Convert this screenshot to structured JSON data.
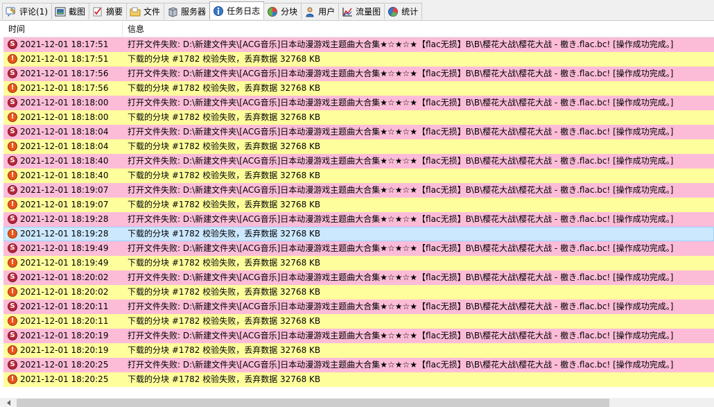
{
  "tabs": [
    {
      "label": "评论(1)",
      "icon": "comment-icon",
      "active": false
    },
    {
      "label": "截图",
      "icon": "screenshot-icon",
      "active": false
    },
    {
      "label": "摘要",
      "icon": "summary-icon",
      "active": false
    },
    {
      "label": "文件",
      "icon": "file-icon",
      "active": false
    },
    {
      "label": "服务器",
      "icon": "server-icon",
      "active": false
    },
    {
      "label": "任务日志",
      "icon": "task-log-icon",
      "active": true
    },
    {
      "label": "分块",
      "icon": "chunk-icon",
      "active": false
    },
    {
      "label": "用户",
      "icon": "user-icon",
      "active": false
    },
    {
      "label": "流量图",
      "icon": "traffic-chart-icon",
      "active": false
    },
    {
      "label": "统计",
      "icon": "statistics-icon",
      "active": false
    }
  ],
  "log": {
    "columns": {
      "time": "时间",
      "info": "信息"
    },
    "rows": [
      {
        "type": "error",
        "time": "2021-12-01 18:17:51",
        "message": "打开文件失败: D:\\新建文件夹\\[ACG音乐]日本动漫游戏主题曲大合集★☆★☆★【flac无损】B\\B\\樱花大战\\樱花大战 - 檄き.flac.bc! [操作成功完成。]"
      },
      {
        "type": "warning",
        "time": "2021-12-01 18:17:51",
        "message": "下载的分块 #1782 校验失败，丢弃数据 32768 KB"
      },
      {
        "type": "error",
        "time": "2021-12-01 18:17:56",
        "message": "打开文件失败: D:\\新建文件夹\\[ACG音乐]日本动漫游戏主题曲大合集★☆★☆★【flac无损】B\\B\\樱花大战\\樱花大战 - 檄き.flac.bc! [操作成功完成。]"
      },
      {
        "type": "warning",
        "time": "2021-12-01 18:17:56",
        "message": "下载的分块 #1782 校验失败，丢弃数据 32768 KB"
      },
      {
        "type": "error",
        "time": "2021-12-01 18:18:00",
        "message": "打开文件失败: D:\\新建文件夹\\[ACG音乐]日本动漫游戏主题曲大合集★☆★☆★【flac无损】B\\B\\樱花大战\\樱花大战 - 檄き.flac.bc! [操作成功完成。]"
      },
      {
        "type": "warning",
        "time": "2021-12-01 18:18:00",
        "message": "下载的分块 #1782 校验失败，丢弃数据 32768 KB"
      },
      {
        "type": "error",
        "time": "2021-12-01 18:18:04",
        "message": "打开文件失败: D:\\新建文件夹\\[ACG音乐]日本动漫游戏主题曲大合集★☆★☆★【flac无损】B\\B\\樱花大战\\樱花大战 - 檄き.flac.bc! [操作成功完成。]"
      },
      {
        "type": "warning",
        "time": "2021-12-01 18:18:04",
        "message": "下载的分块 #1782 校验失败，丢弃数据 32768 KB"
      },
      {
        "type": "error",
        "time": "2021-12-01 18:18:40",
        "message": "打开文件失败: D:\\新建文件夹\\[ACG音乐]日本动漫游戏主题曲大合集★☆★☆★【flac无损】B\\B\\樱花大战\\樱花大战 - 檄き.flac.bc! [操作成功完成。]"
      },
      {
        "type": "warning",
        "time": "2021-12-01 18:18:40",
        "message": "下载的分块 #1782 校验失败，丢弃数据 32768 KB"
      },
      {
        "type": "error",
        "time": "2021-12-01 18:19:07",
        "message": "打开文件失败: D:\\新建文件夹\\[ACG音乐]日本动漫游戏主题曲大合集★☆★☆★【flac无损】B\\B\\樱花大战\\樱花大战 - 檄き.flac.bc! [操作成功完成。]"
      },
      {
        "type": "warning",
        "time": "2021-12-01 18:19:07",
        "message": "下载的分块 #1782 校验失败，丢弃数据 32768 KB"
      },
      {
        "type": "error",
        "time": "2021-12-01 18:19:28",
        "message": "打开文件失败: D:\\新建文件夹\\[ACG音乐]日本动漫游戏主题曲大合集★☆★☆★【flac无损】B\\B\\樱花大战\\樱花大战 - 檄き.flac.bc! [操作成功完成。]"
      },
      {
        "type": "warning",
        "time": "2021-12-01 18:19:28",
        "message": "下载的分块 #1782 校验失败，丢弃数据 32768 KB",
        "selected": true
      },
      {
        "type": "error",
        "time": "2021-12-01 18:19:49",
        "message": "打开文件失败: D:\\新建文件夹\\[ACG音乐]日本动漫游戏主题曲大合集★☆★☆★【flac无损】B\\B\\樱花大战\\樱花大战 - 檄き.flac.bc! [操作成功完成。]"
      },
      {
        "type": "warning",
        "time": "2021-12-01 18:19:49",
        "message": "下载的分块 #1782 校验失败，丢弃数据 32768 KB"
      },
      {
        "type": "error",
        "time": "2021-12-01 18:20:02",
        "message": "打开文件失败: D:\\新建文件夹\\[ACG音乐]日本动漫游戏主题曲大合集★☆★☆★【flac无损】B\\B\\樱花大战\\樱花大战 - 檄き.flac.bc! [操作成功完成。]"
      },
      {
        "type": "warning",
        "time": "2021-12-01 18:20:02",
        "message": "下载的分块 #1782 校验失败，丢弃数据 32768 KB"
      },
      {
        "type": "error",
        "time": "2021-12-01 18:20:11",
        "message": "打开文件失败: D:\\新建文件夹\\[ACG音乐]日本动漫游戏主题曲大合集★☆★☆★【flac无损】B\\B\\樱花大战\\樱花大战 - 檄き.flac.bc! [操作成功完成。]"
      },
      {
        "type": "warning",
        "time": "2021-12-01 18:20:11",
        "message": "下载的分块 #1782 校验失败，丢弃数据 32768 KB"
      },
      {
        "type": "error",
        "time": "2021-12-01 18:20:19",
        "message": "打开文件失败: D:\\新建文件夹\\[ACG音乐]日本动漫游戏主题曲大合集★☆★☆★【flac无损】B\\B\\樱花大战\\樱花大战 - 檄き.flac.bc! [操作成功完成。]"
      },
      {
        "type": "warning",
        "time": "2021-12-01 18:20:19",
        "message": "下载的分块 #1782 校验失败，丢弃数据 32768 KB"
      },
      {
        "type": "error",
        "time": "2021-12-01 18:20:25",
        "message": "打开文件失败: D:\\新建文件夹\\[ACG音乐]日本动漫游戏主题曲大合集★☆★☆★【flac无损】B\\B\\樱花大战\\樱花大战 - 檄き.flac.bc! [操作成功完成。]"
      },
      {
        "type": "warning",
        "time": "2021-12-01 18:20:25",
        "message": "下载的分块 #1782 校验失败，丢弃数据 32768 KB"
      }
    ]
  },
  "colors": {
    "error_row": "#fcbcd8",
    "warning_row": "#fefe9c",
    "selected_row": "#cce8ff",
    "error_icon": "#b8283c",
    "warning_icon": "#e9561a"
  },
  "icon_glyphs": {
    "error": "S",
    "warning": "!"
  }
}
